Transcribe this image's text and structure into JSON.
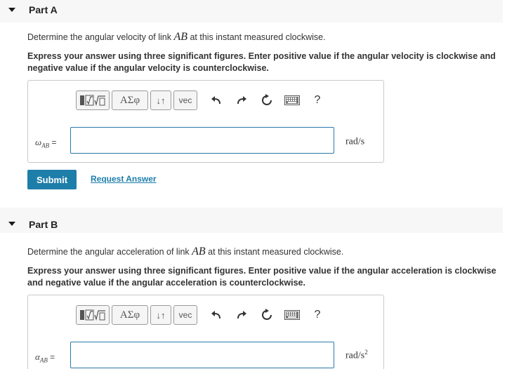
{
  "part_a": {
    "title": "Part A",
    "prompt_before": "Determine the angular velocity of link ",
    "prompt_var": "AB",
    "prompt_after": " at this instant measured clockwise.",
    "instructions": "Express your answer using three significant figures. Enter positive value if the angular velocity is clockwise and negative value if the angular velocity is counterclockwise.",
    "var_symbol": "ω",
    "var_sub": "AB",
    "equals": "=",
    "unit_base": "rad/s",
    "unit_sup": "",
    "input_value": "",
    "submit_label": "Submit",
    "request_label": "Request Answer"
  },
  "part_b": {
    "title": "Part B",
    "prompt_before": "Determine the angular acceleration of link ",
    "prompt_var": "AB",
    "prompt_after": " at this instant measured clockwise.",
    "instructions": "Express your answer using three significant figures. Enter positive value if the angular acceleration is clockwise and negative value if the angular acceleration is counterclockwise.",
    "var_symbol": "α",
    "var_sub": "AB",
    "equals": "=",
    "unit_base": "rad/s",
    "unit_sup": "2",
    "input_value": ""
  },
  "toolbar": {
    "greek_label": "ΑΣφ",
    "arrows_label": "↓↑",
    "vec_label": "vec",
    "help_label": "?",
    "icons": [
      "templates-icon",
      "undo-icon",
      "redo-icon",
      "reset-icon",
      "keyboard-icon",
      "help-icon"
    ]
  },
  "colors": {
    "accent": "#1e7eaa",
    "header_bg": "#f7f7f7",
    "input_border": "#2a7aa8"
  }
}
